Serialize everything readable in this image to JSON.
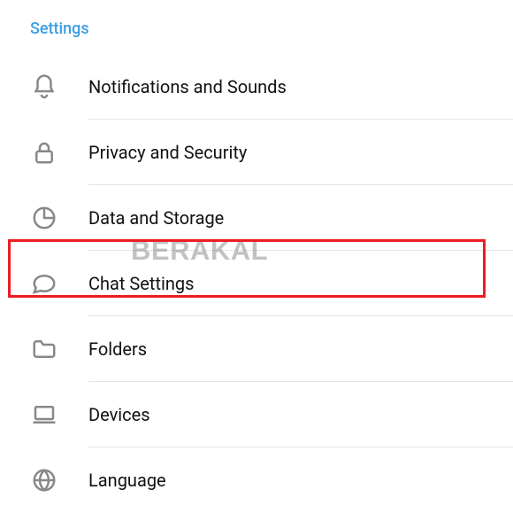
{
  "header": {
    "title": "Settings"
  },
  "items": [
    {
      "label": "Notifications and Sounds"
    },
    {
      "label": "Privacy and Security"
    },
    {
      "label": "Data and Storage"
    },
    {
      "label": "Chat Settings"
    },
    {
      "label": "Folders"
    },
    {
      "label": "Devices"
    },
    {
      "label": "Language"
    }
  ],
  "watermark": "BERAKAL"
}
